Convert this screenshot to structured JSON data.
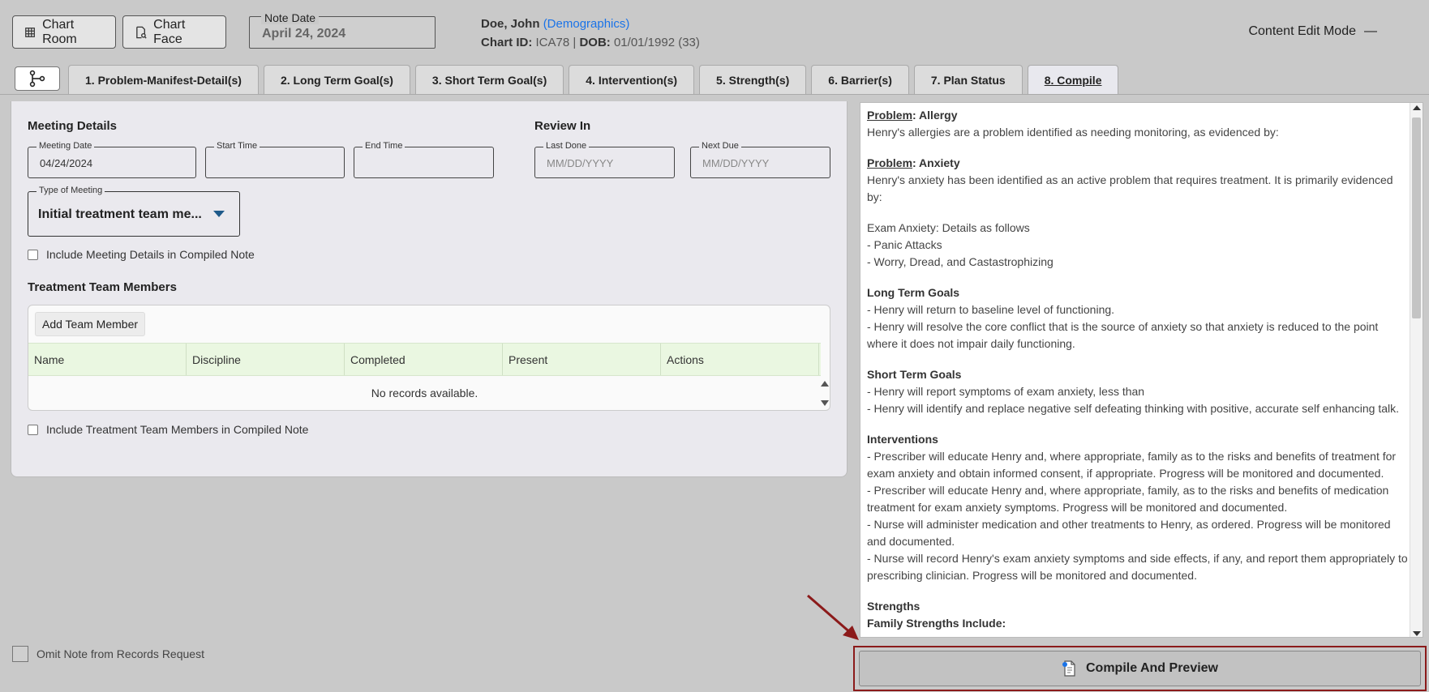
{
  "header": {
    "chart_room_label": "Chart Room",
    "chart_face_label": "Chart Face",
    "note_date_label": "Note Date",
    "note_date_value": "April 24, 2024",
    "patient_name": "Doe, John",
    "demographics_link": "(Demographics)",
    "chart_id_label": "Chart ID:",
    "chart_id_value": "ICA78",
    "separator": "|",
    "dob_label": "DOB:",
    "dob_value": "01/01/1992 (33)",
    "content_edit_mode": "Content Edit Mode",
    "content_edit_dash": "—"
  },
  "tabs": [
    {
      "label": "1. Problem-Manifest-Detail(s)"
    },
    {
      "label": "2. Long Term Goal(s)"
    },
    {
      "label": "3. Short Term Goal(s)"
    },
    {
      "label": "4. Intervention(s)"
    },
    {
      "label": "5. Strength(s)"
    },
    {
      "label": "6. Barrier(s)"
    },
    {
      "label": "7. Plan Status"
    },
    {
      "label": "8. Compile"
    }
  ],
  "meeting": {
    "title": "Meeting Details",
    "meeting_date_label": "Meeting Date",
    "meeting_date_value": "04/24/2024",
    "start_time_label": "Start Time",
    "end_time_label": "End Time",
    "type_label": "Type of Meeting",
    "type_value": "Initial treatment team me...",
    "include_label": "Include Meeting Details in Compiled Note"
  },
  "review": {
    "title": "Review In",
    "last_done_label": "Last Done",
    "last_done_placeholder": "MM/DD/YYYY",
    "next_due_label": "Next Due",
    "next_due_placeholder": "MM/DD/YYYY"
  },
  "team": {
    "title": "Treatment Team Members",
    "add_label": "Add Team Member",
    "columns": [
      "Name",
      "Discipline",
      "Completed",
      "Present",
      "Actions"
    ],
    "empty_text": "No records available.",
    "include_label": "Include Treatment Team Members in Compiled Note"
  },
  "omit_label": "Omit Note from Records Request",
  "preview": {
    "p1_label": "Problem",
    "p1_name": ": Allergy",
    "p1_text": "Henry's allergies are a problem identified as needing monitoring, as evidenced by:",
    "p2_label": "Problem",
    "p2_name": ": Anxiety",
    "p2_text": "Henry's anxiety has been identified as an active problem that requires treatment. It is primarily evidenced by:",
    "exam": "Exam Anxiety: Details as follows",
    "exam_items": [
      "- Panic Attacks",
      "- Worry, Dread, and Castastrophizing"
    ],
    "ltg_title": "Long Term Goals",
    "ltg_items": [
      "-  Henry will return to baseline level of functioning.",
      "-  Henry will resolve the core conflict that is the source of anxiety so that anxiety is reduced to the point where it does not impair daily functioning."
    ],
    "stg_title": "Short Term Goals",
    "stg_items": [
      "-  Henry will report symptoms of exam anxiety, less than",
      "-  Henry will identify and replace negative self defeating thinking with positive, accurate self enhancing talk."
    ],
    "int_title": "Interventions",
    "int_items": [
      "-  Prescriber will educate Henry and, where appropriate, family as to the risks and benefits of treatment for exam anxiety and obtain informed consent, if appropriate. Progress will be monitored and documented.",
      "-  Prescriber will educate Henry and, where appropriate, family, as to the risks and benefits of medication treatment for exam anxiety symptoms. Progress will be monitored and documented.",
      "-  Nurse will administer medication and other treatments to Henry, as ordered. Progress will be monitored and documented.",
      "-  Nurse will record Henry's exam anxiety symptoms and side effects, if any, and report them appropriately to prescribing clinician. Progress will be monitored and documented."
    ],
    "str_title": "Strengths",
    "str_sub": "Family Strengths Include:"
  },
  "compile_label": "Compile And Preview",
  "colors": {
    "accent_border": "#8b1a1a",
    "link": "#1a73e8",
    "grid_header": "#eaf7e1"
  }
}
